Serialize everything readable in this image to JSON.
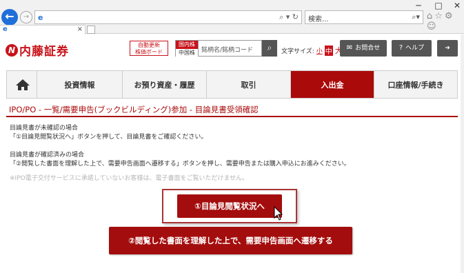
{
  "browser": {
    "window_controls": [
      "─",
      "□",
      "✕"
    ],
    "search_placeholder": "検索...",
    "address_controls": "⌕ ▾ ↻"
  },
  "header": {
    "logo_text": "内藤証券",
    "board_button": [
      "自動更新",
      "株価ボード"
    ],
    "market_top": "国内株",
    "market_bottom": "中国株",
    "stock_placeholder": "銘柄名/銘柄コード",
    "font_size_label": "文字サイズ:",
    "font_small": "小",
    "font_medium": "中",
    "font_large": "大",
    "inquiry_label": "お問合せ",
    "help_label": "ヘルプ"
  },
  "nav": {
    "items": [
      {
        "label": "投資情報"
      },
      {
        "label": "お預り資産・履歴"
      },
      {
        "label": "取引"
      },
      {
        "label": "入出金"
      },
      {
        "label": "口座情報/手続き"
      }
    ]
  },
  "main": {
    "title": "IPO/PO - 一覧/需要申告(ブックビルディング)参加 - 目論見書受領確認",
    "para1_heading": "目論見書が未確認の場合",
    "para1_body": "「①目論見閲覧状況へ」ボタンを押して、目論見書をご確認ください。",
    "para2_heading": "目論見書が確認済みの場合",
    "para2_body": "「②閲覧した書面を理解した上で、需要申告画面へ遷移する」ボタンを押し、需要申告または購入申込にお進みください。",
    "note": "※IPO電子交付サービスに承諾していないお客様は、電子書面をご覧いただけません。",
    "button1_label": "①目論見閲覧状況へ",
    "button2_label": "②閲覧した書面を理解した上で、需要申告画面へ遷移する"
  },
  "colors": {
    "brand_red": "#c8121a",
    "button_red": "#a40d0d",
    "nav_active": "#aa0a0a"
  }
}
